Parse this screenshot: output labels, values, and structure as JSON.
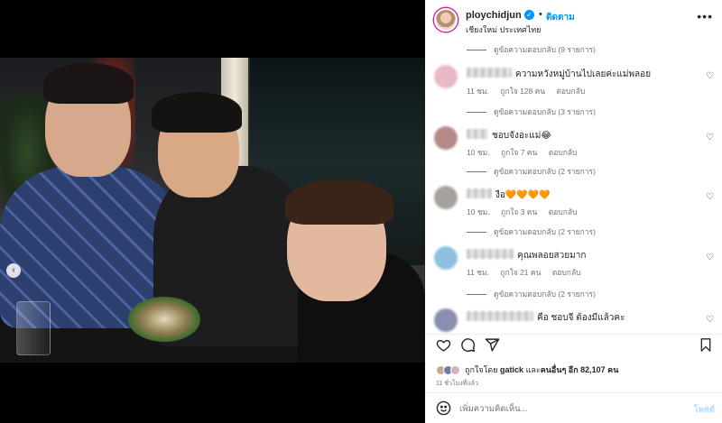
{
  "photo": {
    "alt": "Photo of three friends at a restaurant table"
  },
  "header": {
    "username": "ploychidjun",
    "separator": "•",
    "follow_label": "ติดตาม",
    "location": "เชียงใหม่ ประเทศไทย",
    "more_label": "•••"
  },
  "comments": [
    {
      "type": "reply",
      "label": "ดูข้อความตอบกลับ (9 รายการ)"
    },
    {
      "type": "comment",
      "text": "ความหวังหมู่บ้านไปเลยค่ะแม่พลอย",
      "time": "11 ชม.",
      "likes": "ถูกใจ 128 คน",
      "reply": "ตอบกลับ",
      "avatar_color": "#e7b9c4"
    },
    {
      "type": "reply",
      "label": "ดูข้อความตอบกลับ (3 รายการ)"
    },
    {
      "type": "comment",
      "text": "ชอบจังอะแม่😂",
      "time": "10 ชม.",
      "likes": "ถูกใจ 7 คน",
      "reply": "ตอบกลับ",
      "avatar_color": "#b58a88"
    },
    {
      "type": "reply",
      "label": "ดูข้อความตอบกลับ (2 รายการ)"
    },
    {
      "type": "comment",
      "text": "งือ",
      "emoji": "🧡🧡🧡🧡",
      "time": "10 ชม.",
      "likes": "ถูกใจ 3 คน",
      "reply": "ตอบกลับ",
      "avatar_color": "#a7a19e"
    },
    {
      "type": "reply",
      "label": "ดูข้อความตอบกลับ (2 รายการ)"
    },
    {
      "type": "comment",
      "text": "คุณพลอยสวยมาก",
      "time": "11 ชม.",
      "likes": "ถูกใจ 21 คน",
      "reply": "ตอบกลับ",
      "avatar_color": "#8fbfe0"
    },
    {
      "type": "reply",
      "label": "ดูข้อความตอบกลับ (2 รายการ)"
    },
    {
      "type": "comment",
      "text": "คือ ชอบจี ต้องมีแล้วคะ",
      "time": "",
      "likes": "",
      "reply": "",
      "avatar_color": "#8a8fb0"
    }
  ],
  "actions": {
    "like_icon": "heart-icon",
    "comment_icon": "comment-icon",
    "share_icon": "share-icon",
    "save_icon": "bookmark-icon"
  },
  "likes_line": {
    "prefix": "ถูกใจโดย",
    "user": "gatick",
    "middle": "และ",
    "others": "คนอื่นๆ อีก 82,107 คน"
  },
  "posted_time": "11 ชั่วโมงที่แล้ว",
  "compose": {
    "placeholder": "เพิ่มความคิดเห็น...",
    "post_label": "โพสต์"
  },
  "colors": {
    "accent": "#0095f6",
    "text": "#262626",
    "secondary": "#737373"
  }
}
